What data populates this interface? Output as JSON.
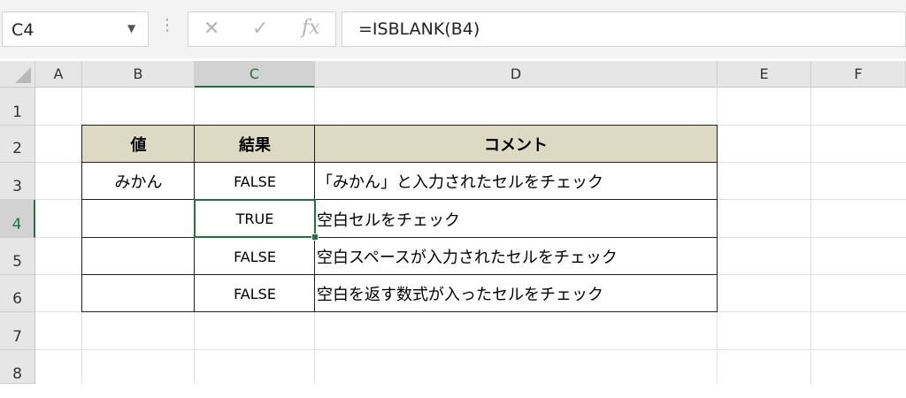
{
  "formula_bar": {
    "name_box": "C4",
    "cancel_icon": "✕",
    "enter_icon": "✓",
    "fx_label": "fx",
    "formula": "=ISBLANK(B4)"
  },
  "columns": [
    "A",
    "B",
    "C",
    "D",
    "E",
    "F"
  ],
  "rows": [
    "1",
    "2",
    "3",
    "4",
    "5",
    "6",
    "7",
    "8"
  ],
  "table": {
    "headers": [
      "値",
      "結果",
      "コメント"
    ],
    "rows": [
      {
        "value": "みかん",
        "result": "FALSE",
        "comment": "「みかん」と入力されたセルをチェック"
      },
      {
        "value": "",
        "result": "TRUE",
        "comment": "空白セルをチェック"
      },
      {
        "value": "",
        "result": "FALSE",
        "comment": "空白スペースが入力されたセルをチェック"
      },
      {
        "value": "",
        "result": "FALSE",
        "comment": "空白を返す数式が入ったセルをチェック"
      }
    ]
  },
  "selection": {
    "active_cell": "C4",
    "accent_color": "#217346"
  },
  "colors": {
    "table_header_fill": "#ddd9c3"
  }
}
